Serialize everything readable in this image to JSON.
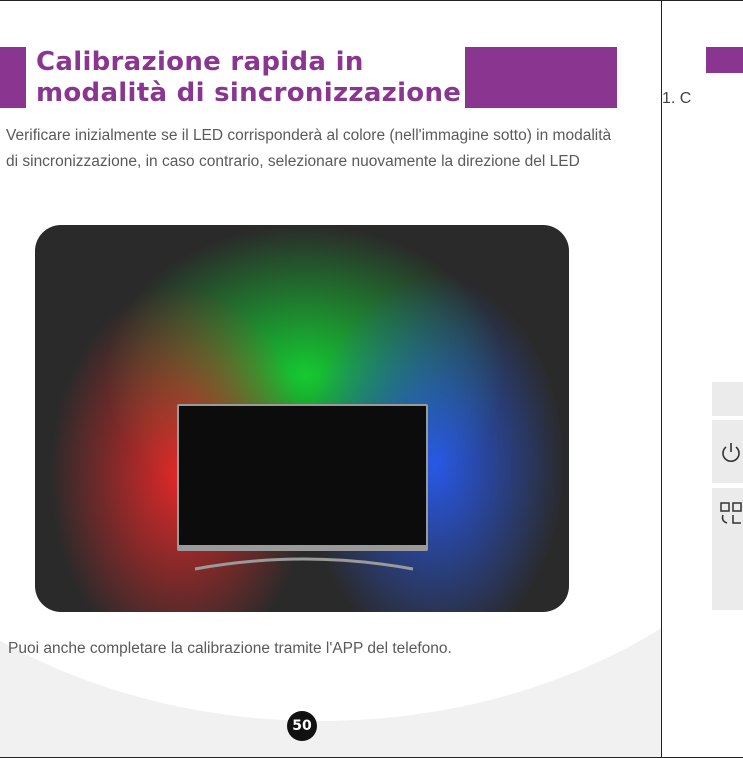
{
  "left_page": {
    "title": "Calibrazione rapida in modalità di sincronizzazione",
    "intro": "Verificare inizialmente se il LED corrisponderà al colore (nell'immagine sotto) in modalità di sincronizzazione, in caso contrario, selezionare nuovamente la direzione del LED",
    "tip": "Puoi anche completare la calibrazione tramite l'APP del telefono.",
    "page_number": "50",
    "accent_color": "#8a3590"
  },
  "right_page": {
    "step_text": "1. C",
    "icons": [
      "power-icon",
      "scan-icon"
    ]
  }
}
